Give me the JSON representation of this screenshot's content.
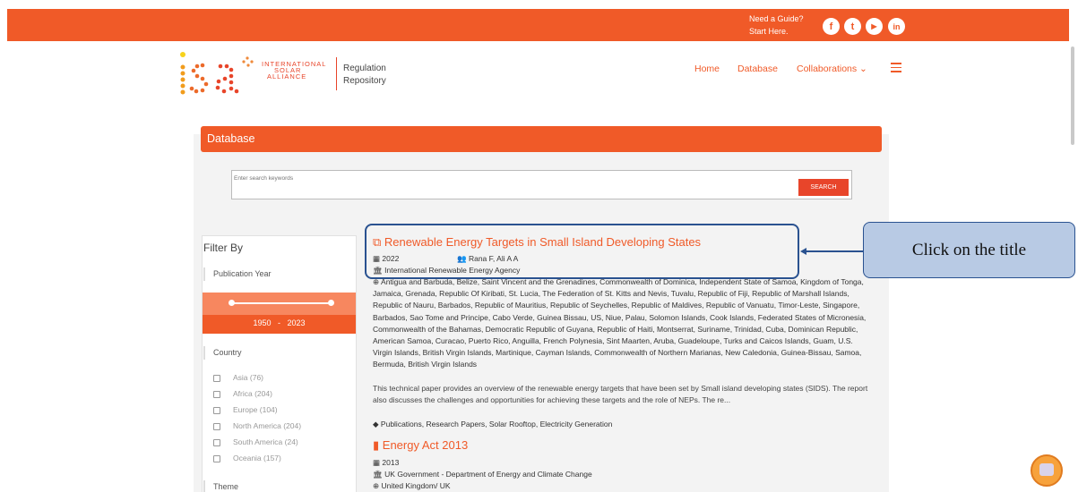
{
  "topbar": {
    "guide_line1": "Need a Guide?",
    "guide_line2": "Start Here.",
    "social": [
      {
        "name": "facebook-icon",
        "glyph": "f"
      },
      {
        "name": "twitter-icon",
        "glyph": "t"
      },
      {
        "name": "youtube-icon",
        "glyph": "▶"
      },
      {
        "name": "linkedin-icon",
        "glyph": "in"
      }
    ]
  },
  "brand": {
    "logo": "isa",
    "name_line1": "INTERNATIONAL",
    "name_line2": "SOLAR",
    "name_line3": "ALLIANCE",
    "repo_line1": "Regulation",
    "repo_line2": "Repository"
  },
  "nav": {
    "home": "Home",
    "database": "Database",
    "collaborations": "Collaborations ⌄"
  },
  "database": {
    "header": "Database",
    "search_placeholder": "Enter search keywords",
    "search_button": "SEARCH"
  },
  "filter": {
    "title": "Filter By",
    "publication_year": "Publication Year",
    "range_from": "1950",
    "range_sep": "-",
    "range_to": "2023",
    "country": "Country",
    "countries": [
      "Asia (76)",
      "Africa (204)",
      "Europe (104)",
      "North America (204)",
      "South America (24)",
      "Oceania (157)"
    ],
    "theme": "Theme"
  },
  "results": [
    {
      "title": "Renewable Energy Targets in Small Island Developing States",
      "year": "2022",
      "authors": "Rana F, Ali A A",
      "agency": "International Renewable Energy Agency",
      "countries": "Antigua and Barbuda, Belize, Saint Vincent and the Grenadines, Commonwealth of Dominica, Independent State of Samoa, Kingdom of Tonga, Jamaica, Grenada, Republic Of Kiribati, St. Lucia, The Federation of St. Kitts and Nevis, Tuvalu, Republic of Fiji, Republic of Marshall Islands, Republic of Nauru, Barbados, Republic of Mauritius, Republic of Seychelles, Republic of Maldives, Republic of Vanuatu, Timor-Leste, Singapore, Barbados, Sao Tome and Principe, Cabo Verde, Guinea Bissau, US, Niue, Palau, Solomon Islands, Cook Islands, Federated States of Micronesia, Commonwealth of the Bahamas, Democratic Republic of Guyana, Republic of Haiti, Montserrat, Suriname, Trinidad, Cuba, Dominican Republic, American Samoa, Curacao, Puerto Rico, Anguilla, French Polynesia, Sint Maarten, Aruba, Guadeloupe, Turks and Caicos Islands, Guam, U.S. Virgin Islands, British Virgin Islands, Martinique, Cayman Islands, Commonwealth of Northern Marianas, New Caledonia, Guinea-Bissau, Samoa, Bermuda, British Virgin Islands",
      "description": "This technical paper provides an overview of the renewable energy targets that have been set by Small island developing states (SIDS). The report also discusses the challenges and opportunities for achieving these targets and the role of NEPs. The re...",
      "tags": "Publications, Research Papers, Solar Rooftop, Electricity Generation"
    },
    {
      "title": "Energy Act 2013",
      "year": "2013",
      "agency": "UK Government - Department of Energy and Climate Change",
      "countries": "United Kingdom/ UK"
    }
  ],
  "annotation": {
    "callout": "Click on the title"
  },
  "colors": {
    "brand_orange": "#f05a28",
    "annotation_blue": "#2a5290",
    "callout_fill": "#b8cae4"
  }
}
